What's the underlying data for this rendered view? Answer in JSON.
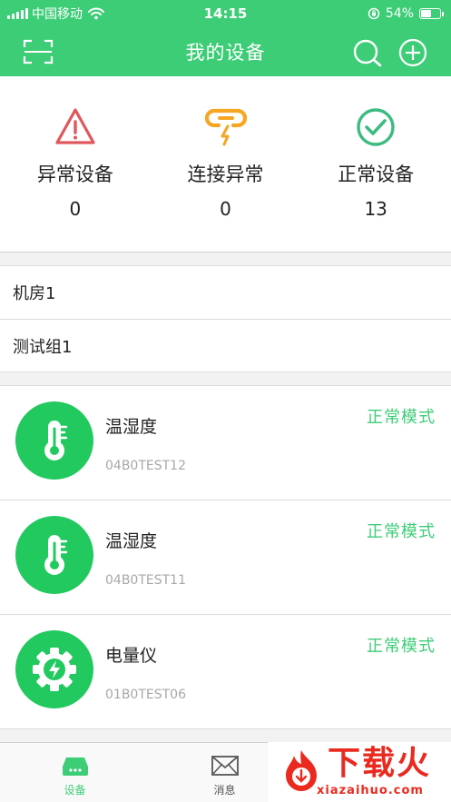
{
  "status_bar": {
    "carrier": "中国移动",
    "time": "14:15",
    "battery_percent": "54%",
    "battery_level": 0.54
  },
  "header": {
    "title": "我的设备",
    "icons": [
      "scan-icon",
      "search-icon",
      "add-icon"
    ]
  },
  "stats": [
    {
      "label": "异常设备",
      "count": "0",
      "icon": "warning-icon",
      "color": "#e0575c"
    },
    {
      "label": "连接异常",
      "count": "0",
      "icon": "broken-link-icon",
      "color": "#f5a623"
    },
    {
      "label": "正常设备",
      "count": "13",
      "icon": "check-circle-icon",
      "color": "#3dbb80"
    }
  ],
  "groups": [
    {
      "name": "机房1"
    },
    {
      "name": "测试组1"
    }
  ],
  "devices": [
    {
      "name": "温湿度",
      "code": "04B0TEST12",
      "mode": "正常模式",
      "icon": "thermometer-icon"
    },
    {
      "name": "温湿度",
      "code": "04B0TEST11",
      "mode": "正常模式",
      "icon": "thermometer-icon"
    },
    {
      "name": "电量仪",
      "code": "01B0TEST06",
      "mode": "正常模式",
      "icon": "power-gear-icon"
    }
  ],
  "tabbar": {
    "tabs": [
      {
        "label": "设备",
        "icon": "device-icon",
        "active": true
      },
      {
        "label": "消息",
        "icon": "mail-icon",
        "active": false
      }
    ]
  },
  "watermark": {
    "text": "下载火",
    "url": "xiazaihuo.com"
  },
  "colors": {
    "brand": "#3dcd76",
    "device_icon_bg": "#22c95f",
    "watermark_red": "#ea2a1f"
  }
}
